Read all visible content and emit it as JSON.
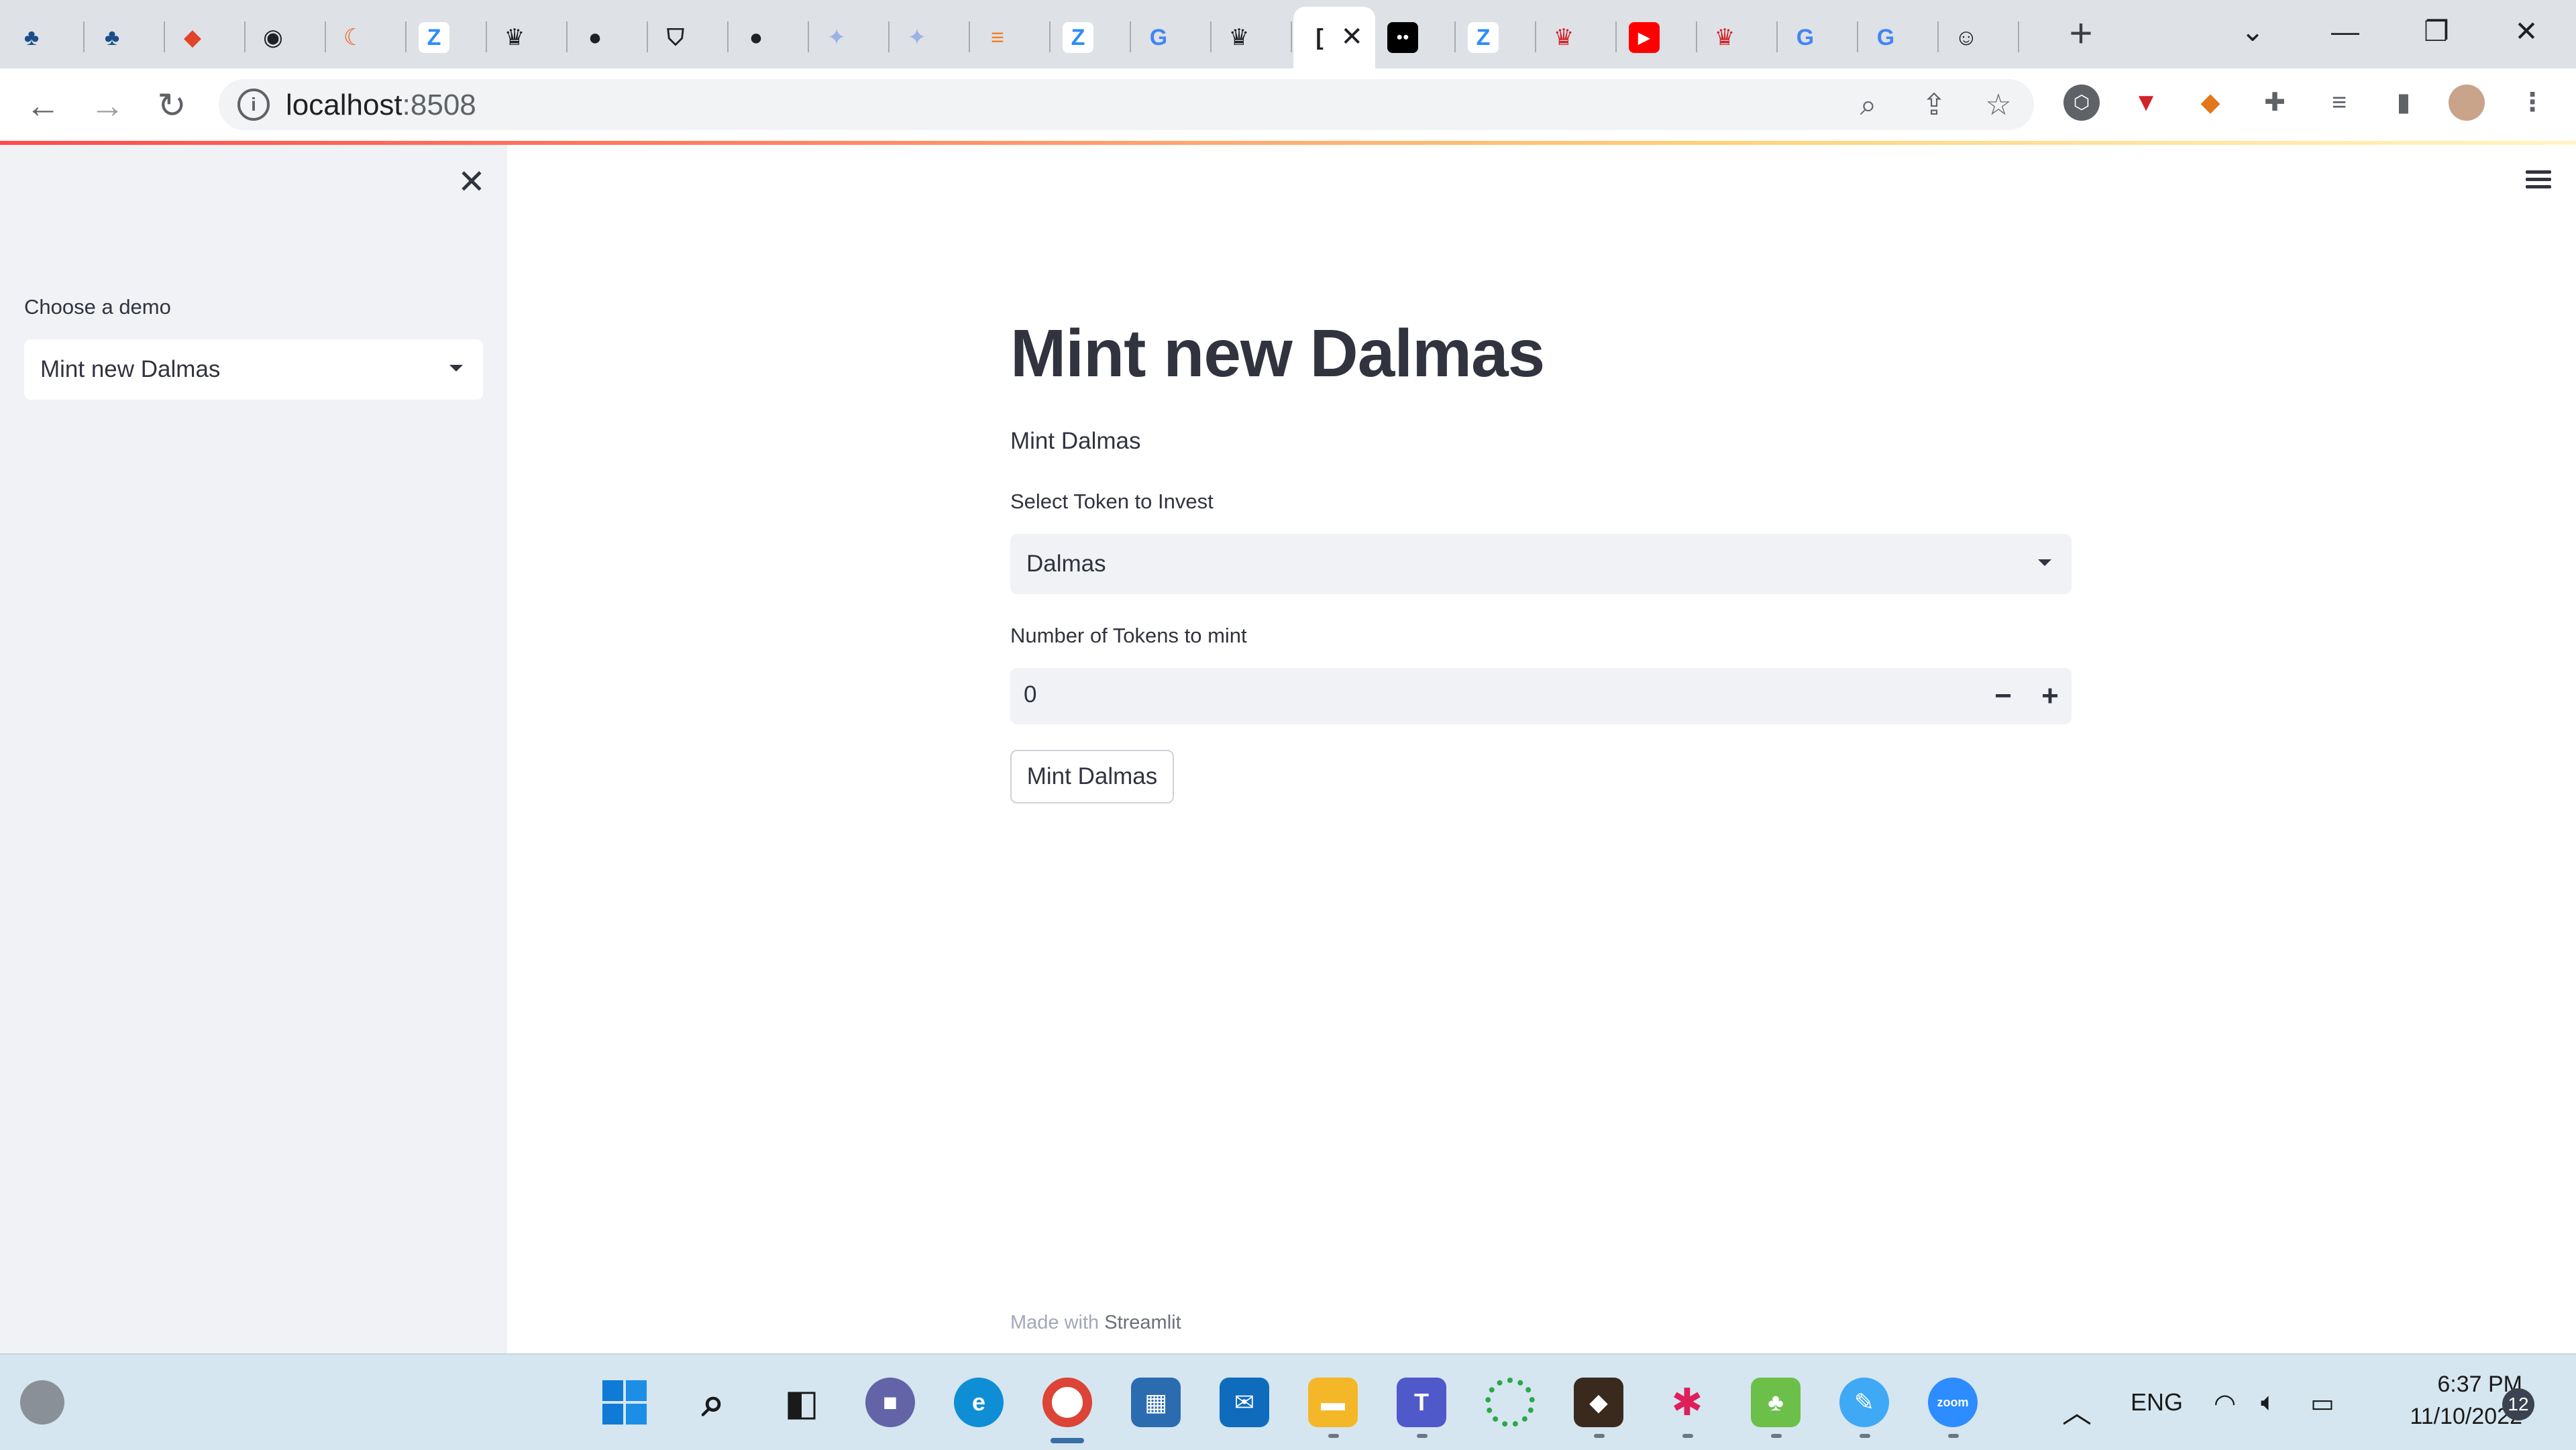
{
  "browser": {
    "tabs": [
      {
        "icon": "tree-icon",
        "color": "#1a4e8a"
      },
      {
        "icon": "tree-icon",
        "color": "#1a4e8a"
      },
      {
        "icon": "gitlab-icon",
        "color": "#e24329"
      },
      {
        "icon": "brain-icon",
        "color": "#202124"
      },
      {
        "icon": "crescent-icon",
        "color": "#f26522"
      },
      {
        "icon": "z-icon",
        "color": "#2d8cff"
      },
      {
        "icon": "crown-icon",
        "color": "#202124"
      },
      {
        "icon": "github-icon",
        "color": "#202124"
      },
      {
        "icon": "shield-icon",
        "color": "#202124"
      },
      {
        "icon": "github-icon",
        "color": "#202124"
      },
      {
        "icon": "bulb-icon",
        "color": "#9bb3e6"
      },
      {
        "icon": "bulb-icon",
        "color": "#9bb3e6"
      },
      {
        "icon": "stackoverflow-icon",
        "color": "#f48024"
      },
      {
        "icon": "z-icon",
        "color": "#2d8cff"
      },
      {
        "icon": "google-icon",
        "color": "#4285f4"
      },
      {
        "icon": "crown-icon",
        "color": "#202124"
      },
      {
        "icon": "streamlit-icon",
        "color": "#202124",
        "active": true,
        "label": "["
      },
      {
        "icon": "medium-icon",
        "color": "#000000"
      },
      {
        "icon": "z-icon",
        "color": "#2d8cff"
      },
      {
        "icon": "crown-red-icon",
        "color": "#d3232a"
      },
      {
        "icon": "youtube-icon",
        "color": "#ff0000"
      },
      {
        "icon": "crown-red-icon",
        "color": "#d3232a"
      },
      {
        "icon": "google-icon",
        "color": "#4285f4"
      },
      {
        "icon": "google-icon",
        "color": "#4285f4"
      },
      {
        "icon": "smile-icon",
        "color": "#202124"
      }
    ],
    "url_host": "localhost",
    "url_port": ":8508"
  },
  "sidebar": {
    "label": "Choose a demo",
    "selected": "Mint new Dalmas"
  },
  "main": {
    "title": "Mint new Dalmas",
    "subtitle": "Mint Dalmas",
    "token_label": "Select Token to Invest",
    "token_value": "Dalmas",
    "count_label": "Number of Tokens to mint",
    "count_value": "0",
    "minus": "−",
    "plus": "+",
    "button": "Mint Dalmas"
  },
  "footer": {
    "prefix": "Made with ",
    "brand": "Streamlit"
  },
  "taskbar": {
    "lang": "ENG",
    "time": "6:37 PM",
    "date": "11/10/2022",
    "notifications": "12"
  }
}
